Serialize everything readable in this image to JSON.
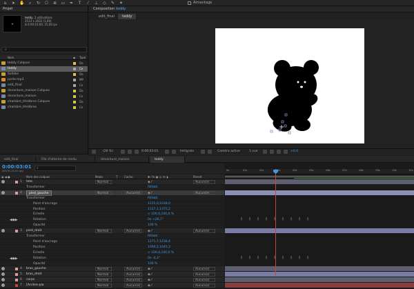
{
  "toolbar": {
    "icons": [
      "home-icon",
      "select-icon",
      "hand-icon",
      "zoom-icon",
      "rotate-icon",
      "camera-icon",
      "pan-behind-icon",
      "rect-mask-icon",
      "pen-icon",
      "text-icon",
      "brush-icon",
      "clone-icon",
      "eraser-icon",
      "roto-icon",
      "puppet-icon"
    ],
    "snap_label": "Aimantage"
  },
  "project": {
    "title": "Projet",
    "selected_name": "teddy",
    "usage": ", 2 utilisations",
    "dimensions": "2513 x 2032 (1,00)",
    "duration": "Δ 0:00:15:00, 25,00 ips",
    "search_placeholder": "",
    "header_name": "Nom",
    "header_type": "Type",
    "items": [
      {
        "name": "teddy Calques",
        "type": "Do",
        "kind": "folder",
        "color": "#d8c64a"
      },
      {
        "name": "teddy",
        "type": "Co",
        "kind": "comp",
        "color": "#a6a6a6",
        "selected": true
      },
      {
        "name": "Solides",
        "type": "Do",
        "kind": "folder",
        "color": "#d8c64a"
      },
      {
        "name": "porte.mp3",
        "type": "MP",
        "kind": "audio",
        "color": "#a6a6a6"
      },
      {
        "name": "edit_final",
        "type": "Co",
        "kind": "comp",
        "color": "#a6a6a6"
      },
      {
        "name": "devanture_maison Calques",
        "type": "Do",
        "kind": "folder",
        "color": "#d8c64a"
      },
      {
        "name": "devanture_maison",
        "type": "Co",
        "kind": "comp",
        "color": "#d8c64a"
      },
      {
        "name": "chambre_ténèbres Calques",
        "type": "Do",
        "kind": "folder",
        "color": "#d8c64a"
      },
      {
        "name": "chambre_ténèbres",
        "type": "Co",
        "kind": "comp",
        "color": "#d8c64a"
      }
    ],
    "footer_bpc": "8 bpc"
  },
  "viewer": {
    "panel_title": "Composition",
    "comp_name": "teddy",
    "tabs": [
      "edit_final",
      "teddy"
    ],
    "active_tab": 1,
    "zoom": "(26 %)",
    "time": "0:00:03:01",
    "resolution": "Intégrale",
    "camera": "Caméra active",
    "views": "1 vue",
    "exposure": "+0,0"
  },
  "timeline": {
    "tabs": [
      "edit_final",
      "File d'attente de rendu",
      "devanture_maison",
      "teddy"
    ],
    "active_tab": 3,
    "timecode": "0:00:03:01",
    "fps": "00076 (25.00 ips)",
    "headers": {
      "name": "Nom des calques",
      "mode": "Mode",
      "track": "T",
      "cache": "Cache",
      "parent": "Parent"
    },
    "rows": [
      {
        "type": "layer",
        "num": "1",
        "name": "tete",
        "mode": "Normal",
        "cache": "",
        "parent": "Aucun(e)",
        "label": "#d8a0a0"
      },
      {
        "type": "prop",
        "name": "Transformer",
        "value": "Rétabl.",
        "indent": 0
      },
      {
        "type": "layer",
        "num": "2",
        "name": "pied_gauche",
        "mode": "Normal",
        "cache": "Aucun(e)",
        "parent": "Aucun(e)",
        "label": "#d8a0a0",
        "selected": true
      },
      {
        "type": "prop",
        "name": "Transformer",
        "value": "Rétabl.",
        "indent": 0
      },
      {
        "type": "prop",
        "name": "Point d'ancrage",
        "value": "1231,0,1038,0",
        "indent": 1
      },
      {
        "type": "prop",
        "name": "Position",
        "value": "1127,1,1375,2",
        "indent": 1
      },
      {
        "type": "prop",
        "name": "Échelle",
        "value": "∞ 100,0,100,0 %",
        "indent": 1
      },
      {
        "type": "prop",
        "name": "Rotation",
        "value": "0x +26,7°",
        "indent": 1,
        "keyframes": true
      },
      {
        "type": "prop",
        "name": "Opacité",
        "value": "100 %",
        "indent": 1
      },
      {
        "type": "layer",
        "num": "3",
        "name": "pied_droit",
        "mode": "Normal",
        "cache": "Aucun(e)",
        "parent": "Aucun(e)",
        "label": "#d8a0a0"
      },
      {
        "type": "prop",
        "name": "Transformer",
        "value": "Rétabl.",
        "indent": 0
      },
      {
        "type": "prop",
        "name": "Point d'ancrage",
        "value": "1271,7,1238,4",
        "indent": 1
      },
      {
        "type": "prop",
        "name": "Position",
        "value": "1090,2,1645,3",
        "indent": 1
      },
      {
        "type": "prop",
        "name": "Échelle",
        "value": "∞ 100,0,100,0 %",
        "indent": 1
      },
      {
        "type": "prop",
        "name": "Rotation",
        "value": "0x -4,3°",
        "indent": 1,
        "keyframes": true
      },
      {
        "type": "prop",
        "name": "Opacité",
        "value": "100 %",
        "indent": 1
      },
      {
        "type": "layer",
        "num": "4",
        "name": "bras_gauche",
        "mode": "Normal",
        "cache": "Aucun(e)",
        "parent": "Aucun(e)",
        "label": "#d8a0a0"
      },
      {
        "type": "layer",
        "num": "5",
        "name": "bras_droit",
        "mode": "Normal",
        "cache": "Aucun(e)",
        "parent": "Aucun(e)",
        "label": "#d8a0a0"
      },
      {
        "type": "layer",
        "num": "6",
        "name": "corps",
        "mode": "Normal",
        "cache": "Aucun(e)",
        "parent": "Aucun(e)",
        "label": "#d8a0a0"
      },
      {
        "type": "layer",
        "num": "7",
        "name": "[Arrière-pla",
        "mode": "Normal",
        "cache": "Aucun(e)",
        "parent": "Aucun(e)",
        "label": "#c84040"
      }
    ],
    "ruler_ticks": [
      "0s",
      "01s",
      "02s",
      "03s",
      "04s",
      "05s",
      "06s",
      "07s",
      "08s",
      "09s",
      "10s",
      "11s"
    ],
    "current_time_s": 3.04,
    "duration_s": 11.4
  },
  "colors": {
    "accent": "#3d9be9",
    "cti": "#d04040"
  }
}
